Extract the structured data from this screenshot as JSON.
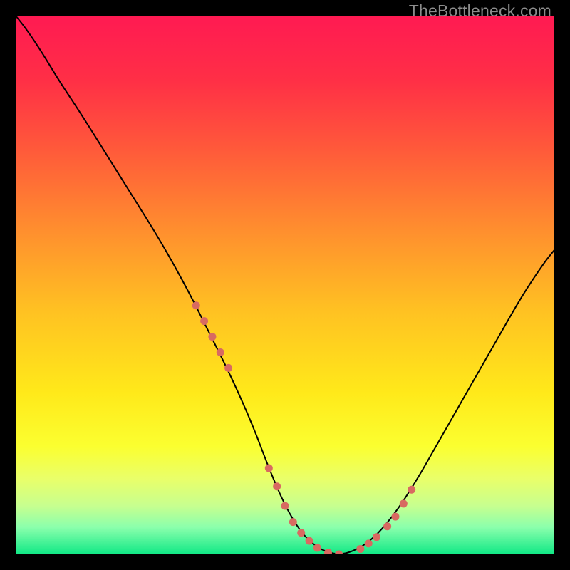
{
  "watermark": "TheBottleneck.com",
  "chart_data": {
    "type": "line",
    "title": "",
    "xlabel": "",
    "ylabel": "",
    "xlim": [
      0,
      100
    ],
    "ylim": [
      0,
      100
    ],
    "grid": false,
    "legend": false,
    "plot_background": {
      "gradient_stops": [
        {
          "offset": 0,
          "color": "#ff1a52"
        },
        {
          "offset": 12,
          "color": "#ff2f46"
        },
        {
          "offset": 25,
          "color": "#ff5a3a"
        },
        {
          "offset": 40,
          "color": "#ff8f2e"
        },
        {
          "offset": 55,
          "color": "#ffc222"
        },
        {
          "offset": 70,
          "color": "#ffe91a"
        },
        {
          "offset": 80,
          "color": "#fbff30"
        },
        {
          "offset": 86,
          "color": "#e9ff6a"
        },
        {
          "offset": 91,
          "color": "#c7ff8f"
        },
        {
          "offset": 95,
          "color": "#8affac"
        },
        {
          "offset": 100,
          "color": "#10e886"
        }
      ]
    },
    "series": [
      {
        "name": "bottleneck-curve",
        "stroke": "#000000",
        "stroke_width": 2,
        "x": [
          0,
          2,
          5,
          8,
          12,
          17,
          22,
          27,
          32,
          36,
          40,
          44,
          47,
          50,
          53,
          56,
          59,
          62,
          66,
          70,
          74,
          78,
          82,
          86,
          90,
          94,
          98,
          100
        ],
        "values": [
          100,
          97.5,
          93,
          88,
          82,
          74,
          66,
          58,
          49,
          41,
          33,
          24,
          16,
          9,
          4,
          1.2,
          0,
          0.2,
          2.5,
          7,
          13,
          20,
          27,
          34,
          41,
          48,
          54,
          56.5
        ]
      }
    ],
    "markers": {
      "name": "highlight-dots",
      "color": "#d86a61",
      "radius": 5.5,
      "x": [
        33.5,
        35,
        36.5,
        38,
        39.5,
        47,
        48.5,
        50,
        51.5,
        53,
        54.5,
        56,
        58,
        60,
        64,
        65.5,
        67,
        69,
        70.5,
        72,
        73.5
      ],
      "values": [
        46.2,
        43.3,
        40.4,
        37.5,
        34.6,
        16,
        12.6,
        9,
        6,
        4,
        2.5,
        1.2,
        0.3,
        0,
        1,
        2,
        3.2,
        5.2,
        7,
        9.4,
        12
      ]
    }
  }
}
